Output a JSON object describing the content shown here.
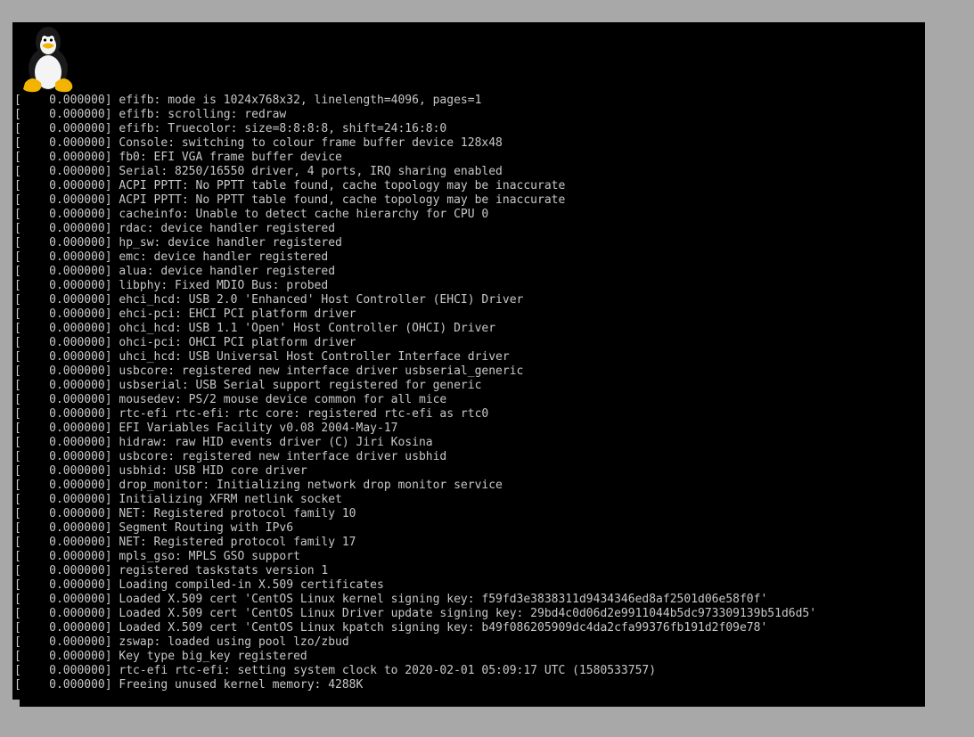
{
  "screen": {
    "logo_icon": "tux-penguin-icon",
    "colors": {
      "background": "#000000",
      "text": "#c8c8c8",
      "bezel": "#a8a8a8"
    }
  },
  "console": {
    "lines": [
      {
        "ts": "[    0.000000]",
        "msg": " efifb: mode is 1024x768x32, linelength=4096, pages=1"
      },
      {
        "ts": "[    0.000000]",
        "msg": " efifb: scrolling: redraw"
      },
      {
        "ts": "[    0.000000]",
        "msg": " efifb: Truecolor: size=8:8:8:8, shift=24:16:8:0"
      },
      {
        "ts": "[    0.000000]",
        "msg": " Console: switching to colour frame buffer device 128x48"
      },
      {
        "ts": "[    0.000000]",
        "msg": " fb0: EFI VGA frame buffer device"
      },
      {
        "ts": "[    0.000000]",
        "msg": " Serial: 8250/16550 driver, 4 ports, IRQ sharing enabled"
      },
      {
        "ts": "[    0.000000]",
        "msg": " ACPI PPTT: No PPTT table found, cache topology may be inaccurate"
      },
      {
        "ts": "[    0.000000]",
        "msg": " ACPI PPTT: No PPTT table found, cache topology may be inaccurate"
      },
      {
        "ts": "[    0.000000]",
        "msg": " cacheinfo: Unable to detect cache hierarchy for CPU 0"
      },
      {
        "ts": "[    0.000000]",
        "msg": " rdac: device handler registered"
      },
      {
        "ts": "[    0.000000]",
        "msg": " hp_sw: device handler registered"
      },
      {
        "ts": "[    0.000000]",
        "msg": " emc: device handler registered"
      },
      {
        "ts": "[    0.000000]",
        "msg": " alua: device handler registered"
      },
      {
        "ts": "[    0.000000]",
        "msg": " libphy: Fixed MDIO Bus: probed"
      },
      {
        "ts": "[    0.000000]",
        "msg": " ehci_hcd: USB 2.0 'Enhanced' Host Controller (EHCI) Driver"
      },
      {
        "ts": "[    0.000000]",
        "msg": " ehci-pci: EHCI PCI platform driver"
      },
      {
        "ts": "[    0.000000]",
        "msg": " ohci_hcd: USB 1.1 'Open' Host Controller (OHCI) Driver"
      },
      {
        "ts": "[    0.000000]",
        "msg": " ohci-pci: OHCI PCI platform driver"
      },
      {
        "ts": "[    0.000000]",
        "msg": " uhci_hcd: USB Universal Host Controller Interface driver"
      },
      {
        "ts": "[    0.000000]",
        "msg": " usbcore: registered new interface driver usbserial_generic"
      },
      {
        "ts": "[    0.000000]",
        "msg": " usbserial: USB Serial support registered for generic"
      },
      {
        "ts": "[    0.000000]",
        "msg": " mousedev: PS/2 mouse device common for all mice"
      },
      {
        "ts": "[    0.000000]",
        "msg": " rtc-efi rtc-efi: rtc core: registered rtc-efi as rtc0"
      },
      {
        "ts": "[    0.000000]",
        "msg": " EFI Variables Facility v0.08 2004-May-17"
      },
      {
        "ts": "[    0.000000]",
        "msg": " hidraw: raw HID events driver (C) Jiri Kosina"
      },
      {
        "ts": "[    0.000000]",
        "msg": " usbcore: registered new interface driver usbhid"
      },
      {
        "ts": "[    0.000000]",
        "msg": " usbhid: USB HID core driver"
      },
      {
        "ts": "[    0.000000]",
        "msg": " drop_monitor: Initializing network drop monitor service"
      },
      {
        "ts": "[    0.000000]",
        "msg": " Initializing XFRM netlink socket"
      },
      {
        "ts": "[    0.000000]",
        "msg": " NET: Registered protocol family 10"
      },
      {
        "ts": "[    0.000000]",
        "msg": " Segment Routing with IPv6"
      },
      {
        "ts": "[    0.000000]",
        "msg": " NET: Registered protocol family 17"
      },
      {
        "ts": "[    0.000000]",
        "msg": " mpls_gso: MPLS GSO support"
      },
      {
        "ts": "[    0.000000]",
        "msg": " registered taskstats version 1"
      },
      {
        "ts": "[    0.000000]",
        "msg": " Loading compiled-in X.509 certificates"
      },
      {
        "ts": "[    0.000000]",
        "msg": " Loaded X.509 cert 'CentOS Linux kernel signing key: f59fd3e3838311d9434346ed8af2501d06e58f0f'"
      },
      {
        "ts": "[    0.000000]",
        "msg": " Loaded X.509 cert 'CentOS Linux Driver update signing key: 29bd4c0d06d2e9911044b5dc973309139b51d6d5'"
      },
      {
        "ts": "[    0.000000]",
        "msg": " Loaded X.509 cert 'CentOS Linux kpatch signing key: b49f086205909dc4da2cfa99376fb191d2f09e78'"
      },
      {
        "ts": "[    0.000000]",
        "msg": " zswap: loaded using pool lzo/zbud"
      },
      {
        "ts": "[    0.000000]",
        "msg": " Key type big_key registered"
      },
      {
        "ts": "[    0.000000]",
        "msg": " rtc-efi rtc-efi: setting system clock to 2020-02-01 05:09:17 UTC (1580533757)"
      },
      {
        "ts": "[    0.000000]",
        "msg": " Freeing unused kernel memory: 4288K"
      }
    ]
  }
}
